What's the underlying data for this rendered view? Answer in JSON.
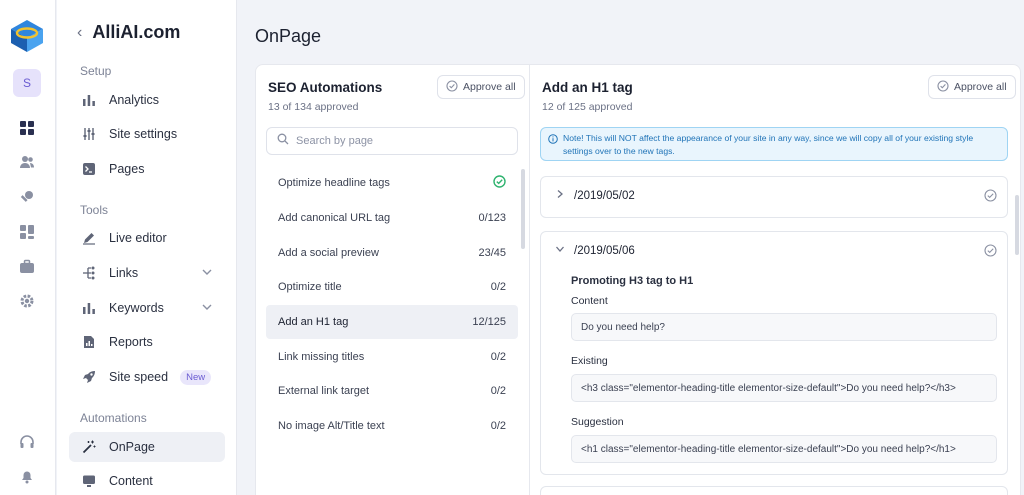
{
  "sidebar": {
    "avatar_letter": "S",
    "brand": "AlliAI.com",
    "sections": {
      "setup": "Setup",
      "tools": "Tools",
      "automations": "Automations"
    },
    "items": [
      {
        "label": "Analytics",
        "icon": "bar-chart-icon"
      },
      {
        "label": "Site settings",
        "icon": "sliders-icon"
      },
      {
        "label": "Pages",
        "icon": "terminal-icon"
      },
      {
        "label": "Live editor",
        "icon": "pencil-icon"
      },
      {
        "label": "Links",
        "icon": "link-tree-icon"
      },
      {
        "label": "Keywords",
        "icon": "bar-chart-icon"
      },
      {
        "label": "Reports",
        "icon": "report-icon"
      },
      {
        "label": "Site speed",
        "icon": "rocket-icon",
        "badge": "New"
      },
      {
        "label": "OnPage",
        "icon": "magic-wand-icon"
      },
      {
        "label": "Content",
        "icon": "monitor-icon"
      }
    ]
  },
  "page_title": "OnPage",
  "seo": {
    "title": "SEO Automations",
    "subtitle": "13 of 134 approved",
    "approve_all": "Approve all",
    "search_placeholder": "Search by page",
    "rows": [
      {
        "label": "Optimize headline tags",
        "count": ""
      },
      {
        "label": "Add canonical URL tag",
        "count": "0/123"
      },
      {
        "label": "Add a social preview",
        "count": "23/45"
      },
      {
        "label": "Optimize title",
        "count": "0/2"
      },
      {
        "label": "Add an H1 tag",
        "count": "12/125"
      },
      {
        "label": "Link missing titles",
        "count": "0/2"
      },
      {
        "label": "External link target",
        "count": "0/2"
      },
      {
        "label": "No image Alt/Title text",
        "count": "0/2"
      }
    ]
  },
  "detail": {
    "title": "Add an H1 tag",
    "subtitle": "12 of 125 approved",
    "approve_all": "Approve all",
    "note": "Note! This will NOT affect the appearance of your site in any way, since we will copy all of your existing style settings over to the new tags.",
    "accordions": [
      {
        "path": "/2019/05/02"
      },
      {
        "path": "/2019/05/06",
        "heading": "Promoting H3 tag to H1",
        "content_label": "Content",
        "content_value": "Do you need help?",
        "existing_label": "Existing",
        "existing_value": "<h3 class=\"elementor-heading-title elementor-size-default\">Do you need help?</h3>",
        "suggestion_label": "Suggestion",
        "suggestion_value": "<h1 class=\"elementor-heading-title elementor-size-default\">Do you need help?</h1>"
      }
    ]
  },
  "colors": {
    "accent": "#6a5bd2",
    "success": "#2fb36f",
    "info": "#1f73b7"
  }
}
